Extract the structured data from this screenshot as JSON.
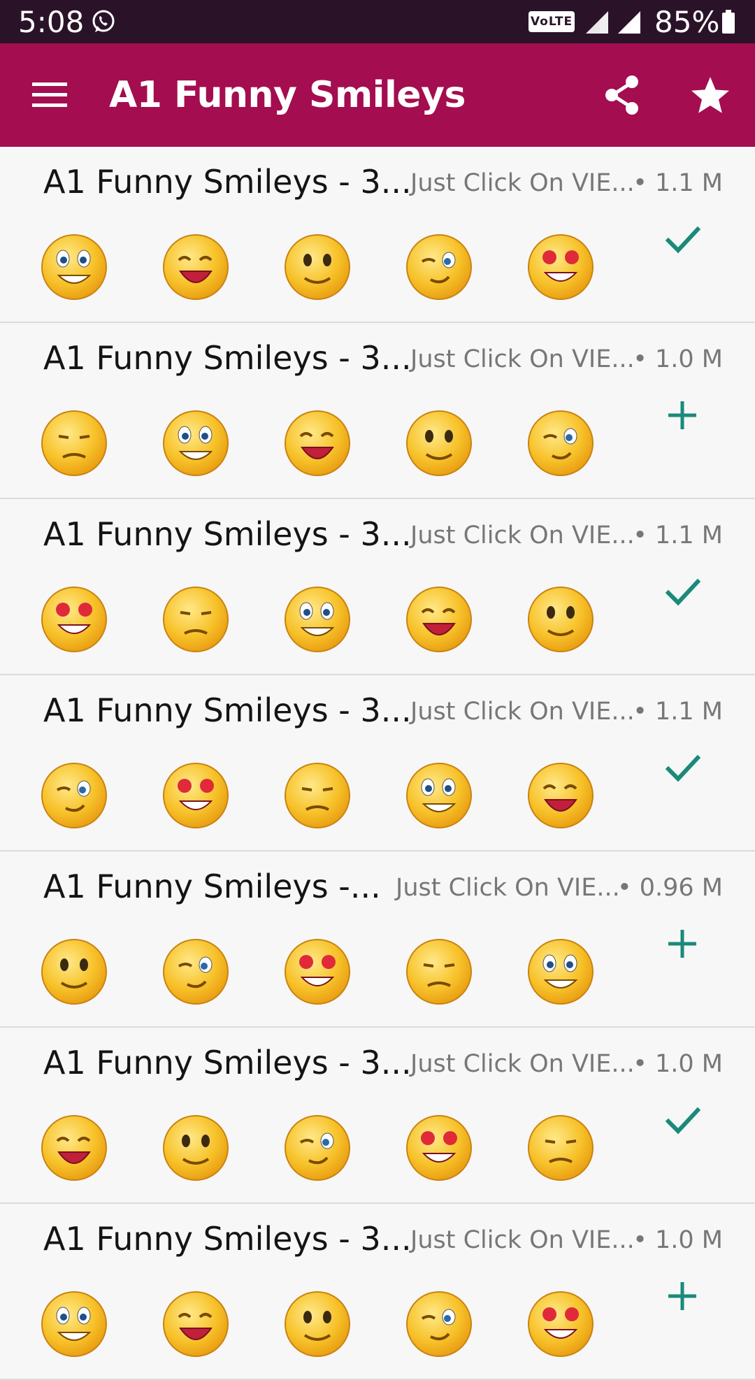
{
  "status_bar": {
    "time": "5:08",
    "volte": "VoLTE",
    "battery": "85%",
    "icons": [
      "whatsapp-icon",
      "signal-icon",
      "signal-icon",
      "battery-icon"
    ]
  },
  "app_bar": {
    "title": "A1 Funny Smileys",
    "icons": [
      "menu-icon",
      "share-icon",
      "star-icon"
    ],
    "color": "#a40d4f"
  },
  "accent_color": "#1a8a7a",
  "packs": [
    {
      "name": "A1 Funny Smileys - 3...",
      "publisher": "Just Click On VIE...",
      "size": "• 1.1 M",
      "status": "added"
    },
    {
      "name": "A1 Funny Smileys - 3...",
      "publisher": "Just Click On VIE...",
      "size": "• 1.0 M",
      "status": "add"
    },
    {
      "name": "A1 Funny Smileys - 3...",
      "publisher": "Just Click On VIE...",
      "size": "• 1.1 M",
      "status": "added"
    },
    {
      "name": "A1 Funny Smileys - 3...",
      "publisher": "Just Click On VIE...",
      "size": "• 1.1 M",
      "status": "added"
    },
    {
      "name": "A1 Funny Smileys -...",
      "publisher": "Just Click On VIE...",
      "size": "• 0.96 M",
      "status": "add"
    },
    {
      "name": "A1 Funny Smileys - 3...",
      "publisher": "Just Click On VIE...",
      "size": "• 1.0 M",
      "status": "added"
    },
    {
      "name": "A1 Funny Smileys - 3...",
      "publisher": "Just Click On VIE...",
      "size": "• 1.0 M",
      "status": "add"
    }
  ]
}
